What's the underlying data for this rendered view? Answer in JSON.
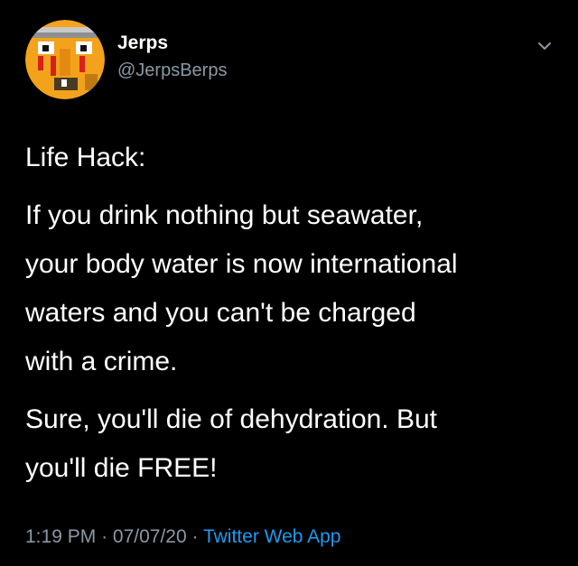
{
  "author": {
    "display_name": "Jerps",
    "handle": "@JerpsBerps"
  },
  "tweet": {
    "title": "Life Hack:",
    "lines_main": [
      "If you drink nothing but seawater,",
      "your body water is now international",
      "waters and you can't be charged",
      "with a crime."
    ],
    "lines_second": [
      "Sure, you'll die of dehydration. But",
      "you'll die FREE!"
    ]
  },
  "meta": {
    "time": "1:19 PM",
    "separator": "·",
    "date": "07/07/20",
    "source": "Twitter Web App"
  },
  "icons": {
    "menu": "chevron-down-icon",
    "avatar": "pixel-face-avatar"
  },
  "colors": {
    "background": "#000000",
    "text": "#ffffff",
    "muted": "#8b98a5",
    "link": "#1d9bf0",
    "avatar_bg": "#f3a21b"
  }
}
